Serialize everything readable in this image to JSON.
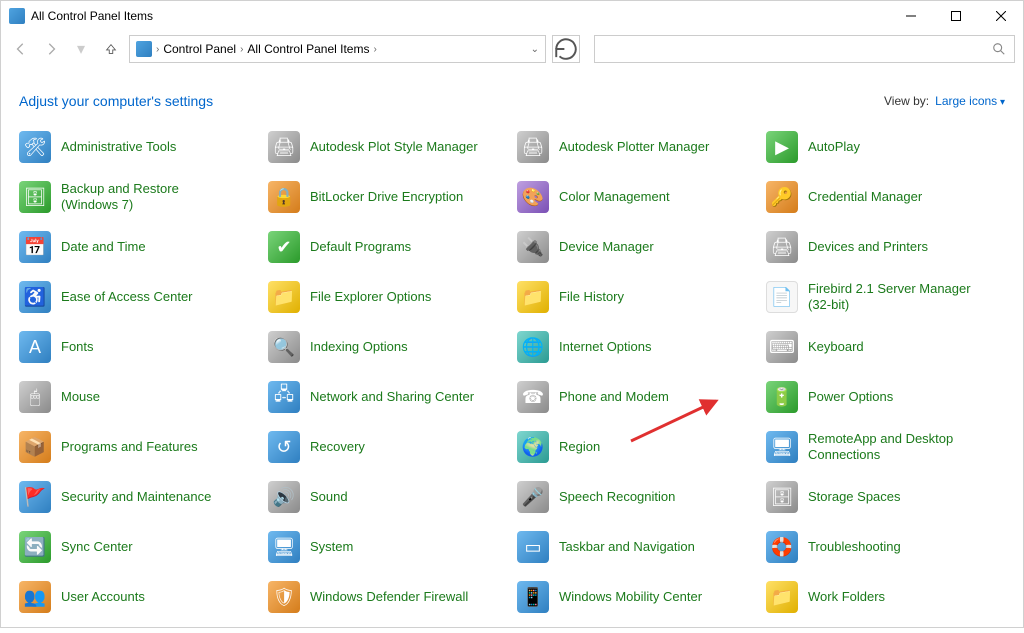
{
  "window": {
    "title": "All Control Panel Items"
  },
  "breadcrumb": {
    "root": "Control Panel",
    "current": "All Control Panel Items"
  },
  "header": {
    "title": "Adjust your computer's settings",
    "viewby_label": "View by:",
    "viewby_value": "Large icons"
  },
  "items": [
    {
      "label": "Administrative Tools",
      "ic": "ic-blue",
      "g": "🛠"
    },
    {
      "label": "Autodesk Plot Style Manager",
      "ic": "ic-gray",
      "g": "🖨"
    },
    {
      "label": "Autodesk Plotter Manager",
      "ic": "ic-gray",
      "g": "🖨"
    },
    {
      "label": "AutoPlay",
      "ic": "ic-green",
      "g": "▶"
    },
    {
      "label": "Backup and Restore (Windows 7)",
      "ic": "ic-green",
      "g": "🗄"
    },
    {
      "label": "BitLocker Drive Encryption",
      "ic": "ic-orange",
      "g": "🔒"
    },
    {
      "label": "Color Management",
      "ic": "ic-purple",
      "g": "🎨"
    },
    {
      "label": "Credential Manager",
      "ic": "ic-orange",
      "g": "🔑"
    },
    {
      "label": "Date and Time",
      "ic": "ic-blue",
      "g": "📅"
    },
    {
      "label": "Default Programs",
      "ic": "ic-green",
      "g": "✔"
    },
    {
      "label": "Device Manager",
      "ic": "ic-gray",
      "g": "🔌"
    },
    {
      "label": "Devices and Printers",
      "ic": "ic-gray",
      "g": "🖨"
    },
    {
      "label": "Ease of Access Center",
      "ic": "ic-blue",
      "g": "♿"
    },
    {
      "label": "File Explorer Options",
      "ic": "ic-yellow",
      "g": "📁"
    },
    {
      "label": "File History",
      "ic": "ic-yellow",
      "g": "📁"
    },
    {
      "label": "Firebird 2.1 Server Manager (32-bit)",
      "ic": "ic-white",
      "g": "📄"
    },
    {
      "label": "Fonts",
      "ic": "ic-blue",
      "g": "A"
    },
    {
      "label": "Indexing Options",
      "ic": "ic-gray",
      "g": "🔍"
    },
    {
      "label": "Internet Options",
      "ic": "ic-teal",
      "g": "🌐"
    },
    {
      "label": "Keyboard",
      "ic": "ic-gray",
      "g": "⌨"
    },
    {
      "label": "Mouse",
      "ic": "ic-gray",
      "g": "🖱"
    },
    {
      "label": "Network and Sharing Center",
      "ic": "ic-blue",
      "g": "🖧"
    },
    {
      "label": "Phone and Modem",
      "ic": "ic-gray",
      "g": "☎"
    },
    {
      "label": "Power Options",
      "ic": "ic-green",
      "g": "🔋"
    },
    {
      "label": "Programs and Features",
      "ic": "ic-orange",
      "g": "📦"
    },
    {
      "label": "Recovery",
      "ic": "ic-blue",
      "g": "↺"
    },
    {
      "label": "Region",
      "ic": "ic-teal",
      "g": "🌍"
    },
    {
      "label": "RemoteApp and Desktop Connections",
      "ic": "ic-blue",
      "g": "🖥"
    },
    {
      "label": "Security and Maintenance",
      "ic": "ic-blue",
      "g": "🚩"
    },
    {
      "label": "Sound",
      "ic": "ic-gray",
      "g": "🔊"
    },
    {
      "label": "Speech Recognition",
      "ic": "ic-gray",
      "g": "🎤"
    },
    {
      "label": "Storage Spaces",
      "ic": "ic-gray",
      "g": "🗄"
    },
    {
      "label": "Sync Center",
      "ic": "ic-green",
      "g": "🔄"
    },
    {
      "label": "System",
      "ic": "ic-blue",
      "g": "🖥"
    },
    {
      "label": "Taskbar and Navigation",
      "ic": "ic-blue",
      "g": "▭"
    },
    {
      "label": "Troubleshooting",
      "ic": "ic-blue",
      "g": "🛟"
    },
    {
      "label": "User Accounts",
      "ic": "ic-orange",
      "g": "👥"
    },
    {
      "label": "Windows Defender Firewall",
      "ic": "ic-orange",
      "g": "🛡"
    },
    {
      "label": "Windows Mobility Center",
      "ic": "ic-blue",
      "g": "📱"
    },
    {
      "label": "Work Folders",
      "ic": "ic-yellow",
      "g": "📁"
    }
  ]
}
